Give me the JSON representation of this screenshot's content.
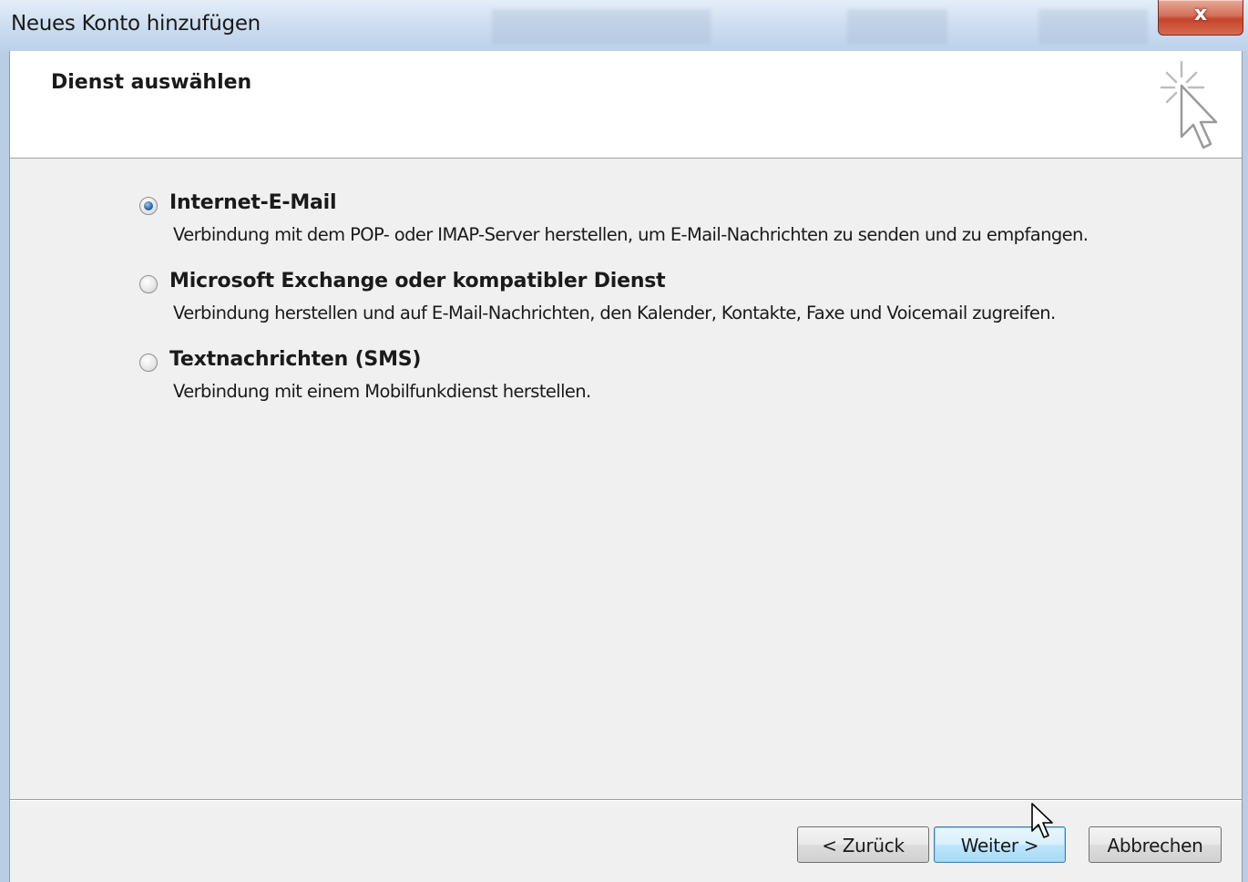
{
  "window": {
    "title": "Neues Konto hinzufügen",
    "close_glyph": "x"
  },
  "header": {
    "title": "Dienst auswählen",
    "icon": "wizard-cursor-sparkle-icon"
  },
  "options": [
    {
      "label": "Internet-E-Mail",
      "description": "Verbindung mit dem POP- oder IMAP-Server herstellen, um E-Mail-Nachrichten zu senden und zu empfangen.",
      "selected": true
    },
    {
      "label": "Microsoft Exchange oder kompatibler Dienst",
      "description": "Verbindung herstellen und auf E-Mail-Nachrichten, den Kalender, Kontakte, Faxe und Voicemail zugreifen.",
      "selected": false
    },
    {
      "label": "Textnachrichten (SMS)",
      "description": "Verbindung mit einem Mobilfunkdienst herstellen.",
      "selected": false
    }
  ],
  "buttons": {
    "back": "< Zurück",
    "next": "Weiter >",
    "cancel": "Abbrechen"
  },
  "colors": {
    "radio_selected": "#2b6ea8",
    "default_button_border": "#3c7fb1",
    "close_button": "#c4452b"
  }
}
